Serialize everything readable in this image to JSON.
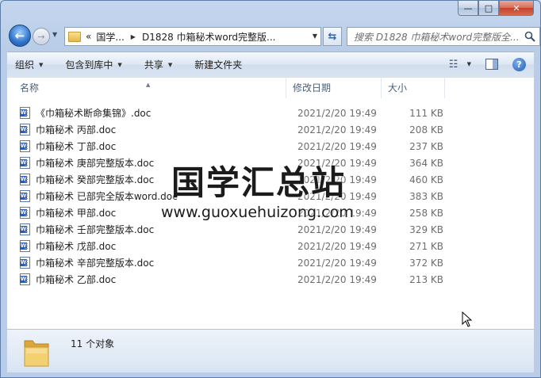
{
  "window": {
    "caption": {
      "minimize": "—",
      "maximize": "□",
      "close": "✕"
    }
  },
  "nav": {
    "back_glyph": "←",
    "forward_glyph": "→",
    "breadcrumb_overflow": "«",
    "breadcrumb": [
      "国学...",
      "D1828 巾箱秘术word完整版..."
    ],
    "search_placeholder": "搜索 D1828 巾箱秘术word完整版全..."
  },
  "toolbar": {
    "organize": "组织",
    "include_in_library": "包含到库中",
    "share": "共享",
    "new_folder": "新建文件夹"
  },
  "columns": {
    "name": "名称",
    "date": "修改日期",
    "size": "大小"
  },
  "files": [
    {
      "name": "《巾箱秘术断命集锦》.doc",
      "date": "2021/2/20 19:49",
      "size": "111 KB"
    },
    {
      "name": "巾箱秘术 丙部.doc",
      "date": "2021/2/20 19:49",
      "size": "208 KB"
    },
    {
      "name": "巾箱秘术 丁部.doc",
      "date": "2021/2/20 19:49",
      "size": "237 KB"
    },
    {
      "name": "巾箱秘术 庚部完整版本.doc",
      "date": "2021/2/20 19:49",
      "size": "364 KB"
    },
    {
      "name": "巾箱秘术 癸部完整版本.doc",
      "date": "2021/2/20 19:49",
      "size": "460 KB"
    },
    {
      "name": "巾箱秘术 已部完全版本word.doc",
      "date": "2021/2/20 19:49",
      "size": "383 KB"
    },
    {
      "name": "巾箱秘术 甲部.doc",
      "date": "2021/2/20 19:49",
      "size": "258 KB"
    },
    {
      "name": "巾箱秘术 壬部完整版本.doc",
      "date": "2021/2/20 19:49",
      "size": "329 KB"
    },
    {
      "name": "巾箱秘术 戊部.doc",
      "date": "2021/2/20 19:49",
      "size": "271 KB"
    },
    {
      "name": "巾箱秘术 辛部完整版本.doc",
      "date": "2021/2/20 19:49",
      "size": "372 KB"
    },
    {
      "name": "巾箱秘术 乙部.doc",
      "date": "2021/2/20 19:49",
      "size": "213 KB"
    }
  ],
  "watermark": {
    "title": "国学汇总站",
    "url": "www.guoxuehuizong.com"
  },
  "status": {
    "count": "11 个对象"
  },
  "colors": {
    "accent": "#2a5bb6",
    "folder": "#e3b84b"
  }
}
